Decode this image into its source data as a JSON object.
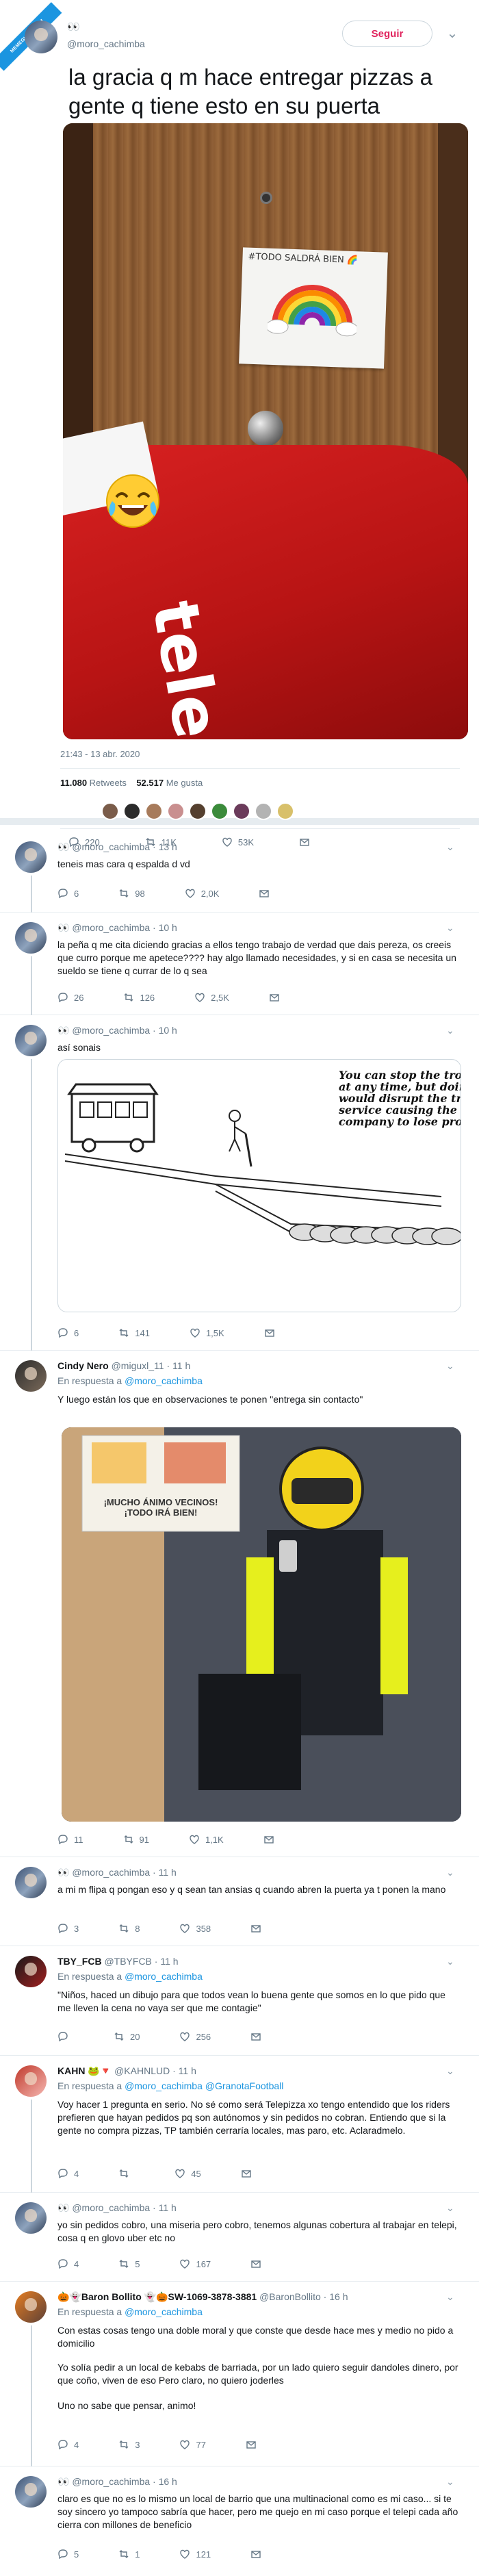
{
  "ribbon": "MEMEGUSTA.COM",
  "main": {
    "name_emoji": "👀",
    "handle": "@moro_cachimba",
    "follow_label": "Seguir",
    "text": "la gracia q m hace entregar pizzas a gente q tiene esto en su puerta",
    "note_text": "#TODO SALDRÁ BIEN 🌈",
    "bag_brand": "telepi",
    "timestamp": "21:43 - 13 abr. 2020",
    "retweets_count": "11.080",
    "retweets_label": "Retweets",
    "likes_count": "52.517",
    "likes_label": "Me gusta",
    "actions": {
      "reply": "220",
      "retweet": "11K",
      "like": "53K"
    }
  },
  "replies": [
    {
      "name": "👀",
      "handle": "@moro_cachimba",
      "time": "13 h",
      "text": "teneis mas cara q espalda d vd",
      "reply_count": "6",
      "retweets": "98",
      "likes": "2,0K"
    },
    {
      "name": "👀",
      "handle": "@moro_cachimba",
      "time": "10 h",
      "text": "la peña q me cita diciendo gracias a ellos tengo trabajo de verdad que dais pereza, os creeis que curro porque me apetece???? hay algo llamado necesidades, y si en casa se necesita un sueldo se tiene q currar de lo q sea",
      "reply_count": "26",
      "retweets": "126",
      "likes": "2,5K"
    },
    {
      "name": "👀",
      "handle": "@moro_cachimba",
      "time": "10 h",
      "text": "así sonais",
      "cartoon_caption": "You can stop the trolley at any time, but doing so would disrupt the trolley service causing the company to lose profits",
      "reply_count": "6",
      "retweets": "141",
      "likes": "1,5K"
    },
    {
      "name": "Cindy Nero",
      "handle": "@miguxl_11",
      "time": "11 h",
      "resp_label": "En respuesta a",
      "resp_to": "@moro_cachimba",
      "text": "Y luego están los que en observaciones te ponen \"entrega sin contacto\"",
      "sign_text": "¡MUCHO ÁNIMO VECINOS! ¡TODO IRÁ BIEN!",
      "reply_count": "11",
      "retweets": "91",
      "likes": "1,1K"
    },
    {
      "name": "👀",
      "handle": "@moro_cachimba",
      "time": "11 h",
      "text": "a mi m flipa q pongan eso y q sean tan ansias q cuando abren la puerta ya t ponen la mano",
      "reply_count": "3",
      "retweets": "8",
      "likes": "358"
    },
    {
      "name": "TBY_FCB",
      "handle": "@TBYFCB",
      "time": "11 h",
      "resp_label": "En respuesta a",
      "resp_to": "@moro_cachimba",
      "text": "\"Niños, haced un dibujo para que todos vean lo buena gente que somos en lo que pido que me lleven la cena no vaya ser que me contagie\"",
      "reply_count": "",
      "retweets": "20",
      "likes": "256"
    },
    {
      "name": "KAHN 🐸🔻",
      "handle": "@KAHNLUD",
      "time": "11 h",
      "resp_label": "En respuesta a",
      "resp_to": "@moro_cachimba @GranotaFootball",
      "text": "Voy hacer 1 pregunta en serio. No sé como será Telepizza xo tengo entendido que los riders prefieren que hayan pedidos pq son autónomos y sin pedidos no cobran. Entiendo que si la gente no compra pizzas, TP también cerraría locales, mas paro, etc. Aclaradmelo.",
      "reply_count": "4",
      "retweets": "",
      "likes": "45"
    },
    {
      "name": "👀",
      "handle": "@moro_cachimba",
      "time": "11 h",
      "text": "yo sin pedidos cobro, una miseria pero cobro, tenemos algunas cobertura al trabajar en telepi, cosa q en glovo uber etc no",
      "reply_count": "4",
      "retweets": "5",
      "likes": "167"
    },
    {
      "name": "🎃👻Baron Bollito 👻🎃SW-1069-3878-3881",
      "handle": "@BaronBollito",
      "time": "16 h",
      "resp_label": "En respuesta a",
      "resp_to": "@moro_cachimba",
      "text": "Con estas cosas tengo una doble moral y que conste que desde hace mes y medio no pido a domicilio",
      "text2": "Yo solía pedir a un local de kebabs de barriada, por un lado quiero seguir dandoles dinero, por que coño, viven de eso Pero claro, no quiero joderles",
      "text3": "Uno no sabe que pensar, animo!",
      "reply_count": "4",
      "retweets": "3",
      "likes": "77"
    },
    {
      "name": "👀",
      "handle": "@moro_cachimba",
      "time": "16 h",
      "text": "claro es que no es lo mismo un local de barrio que una multinacional como es mi caso... si te soy sincero yo tampoco sabría que hacer, pero me quejo en mi caso porque el telepi cada año cierra con millones de beneficio",
      "reply_count": "5",
      "retweets": "1",
      "likes": "121"
    }
  ],
  "colors": {
    "accent": "#1b95e0",
    "like": "#e0245e",
    "muted": "#657786",
    "bag": "#d82121"
  },
  "icons": [
    "reply-icon",
    "retweet-icon",
    "like-icon",
    "mail-icon",
    "chevron-down-icon"
  ]
}
